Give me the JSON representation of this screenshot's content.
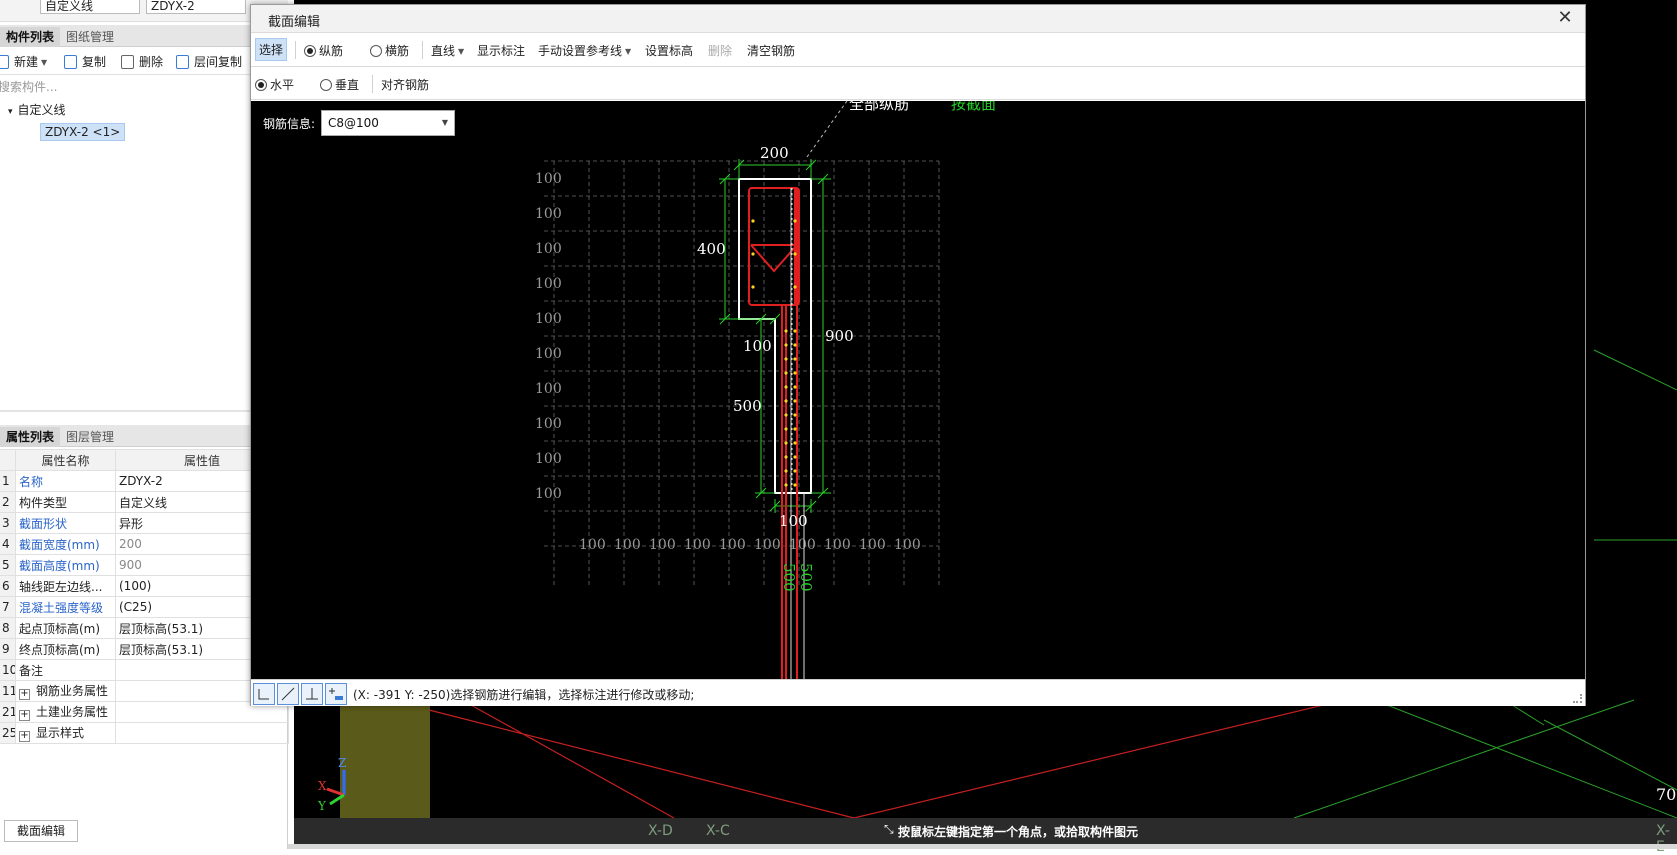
{
  "left": {
    "top_combo_1": "自定义线",
    "top_combo_2": "ZDYX-2",
    "tabs_top": [
      "构件列表",
      "图纸管理"
    ],
    "toolbar": [
      "新建",
      "复制",
      "删除",
      "层间复制"
    ],
    "search_placeholder": "搜索构件...",
    "tree_root": "自定义线",
    "tree_item": "ZDYX-2 <1>",
    "tabs_bottom": [
      "属性列表",
      "图层管理"
    ],
    "prop_headers": [
      "属性名称",
      "属性值"
    ],
    "props": [
      {
        "n": "1",
        "name": "名称",
        "value": "ZDYX-2"
      },
      {
        "n": "2",
        "name": "构件类型",
        "value": "自定义线"
      },
      {
        "n": "3",
        "name": "截面形状",
        "value": "异形"
      },
      {
        "n": "4",
        "name": "截面宽度(mm)",
        "value": "200"
      },
      {
        "n": "5",
        "name": "截面高度(mm)",
        "value": "900"
      },
      {
        "n": "6",
        "name": "轴线距左边线...",
        "value": "(100)"
      },
      {
        "n": "7",
        "name": "混凝土强度等级",
        "value": "(C25)"
      },
      {
        "n": "8",
        "name": "起点顶标高(m)",
        "value": "层顶标高(53.1)"
      },
      {
        "n": "9",
        "name": "终点顶标高(m)",
        "value": "层顶标高(53.1)"
      },
      {
        "n": "10",
        "name": "备注",
        "value": ""
      },
      {
        "n": "11",
        "name": "钢筋业务属性",
        "value": ""
      },
      {
        "n": "21",
        "name": "土建业务属性",
        "value": ""
      },
      {
        "n": "25",
        "name": "显示样式",
        "value": ""
      }
    ],
    "bottom_button": "截面编辑"
  },
  "dialog": {
    "title": "截面编辑",
    "toolbar1": {
      "select": "选择",
      "long_bar": "纵筋",
      "trans_bar": "横筋",
      "line": "直线",
      "show_dim": "显示标注",
      "manual_ref": "手动设置参考线",
      "set_elev": "设置标高",
      "delete": "删除",
      "clear": "清空钢筋"
    },
    "toolbar2": {
      "horizontal": "水平",
      "vertical": "垂直",
      "align": "对齐钢筋"
    },
    "rebar_label": "钢筋信息:",
    "rebar_value": "C8@100",
    "canvas": {
      "anno_all": "全部纵筋",
      "anno_section": "按截面",
      "grid_label": "100",
      "dim_200": "200",
      "dim_400": "400",
      "dim_900": "900",
      "dim_100a": "100",
      "dim_500": "500",
      "dim_100b": "100",
      "dim_500v": "500"
    },
    "status": "(X: -391 Y: -250)选择钢筋进行编辑，选择标注进行修改或移动;"
  },
  "viewport": {
    "axis_labels": [
      "X-D",
      "X-C"
    ],
    "axis_label_right": "X-E",
    "hint": "按鼠标左键指定第一个角点，或拾取构件图元",
    "number_70": "70",
    "axes": [
      "Z",
      "X",
      "Y"
    ]
  }
}
